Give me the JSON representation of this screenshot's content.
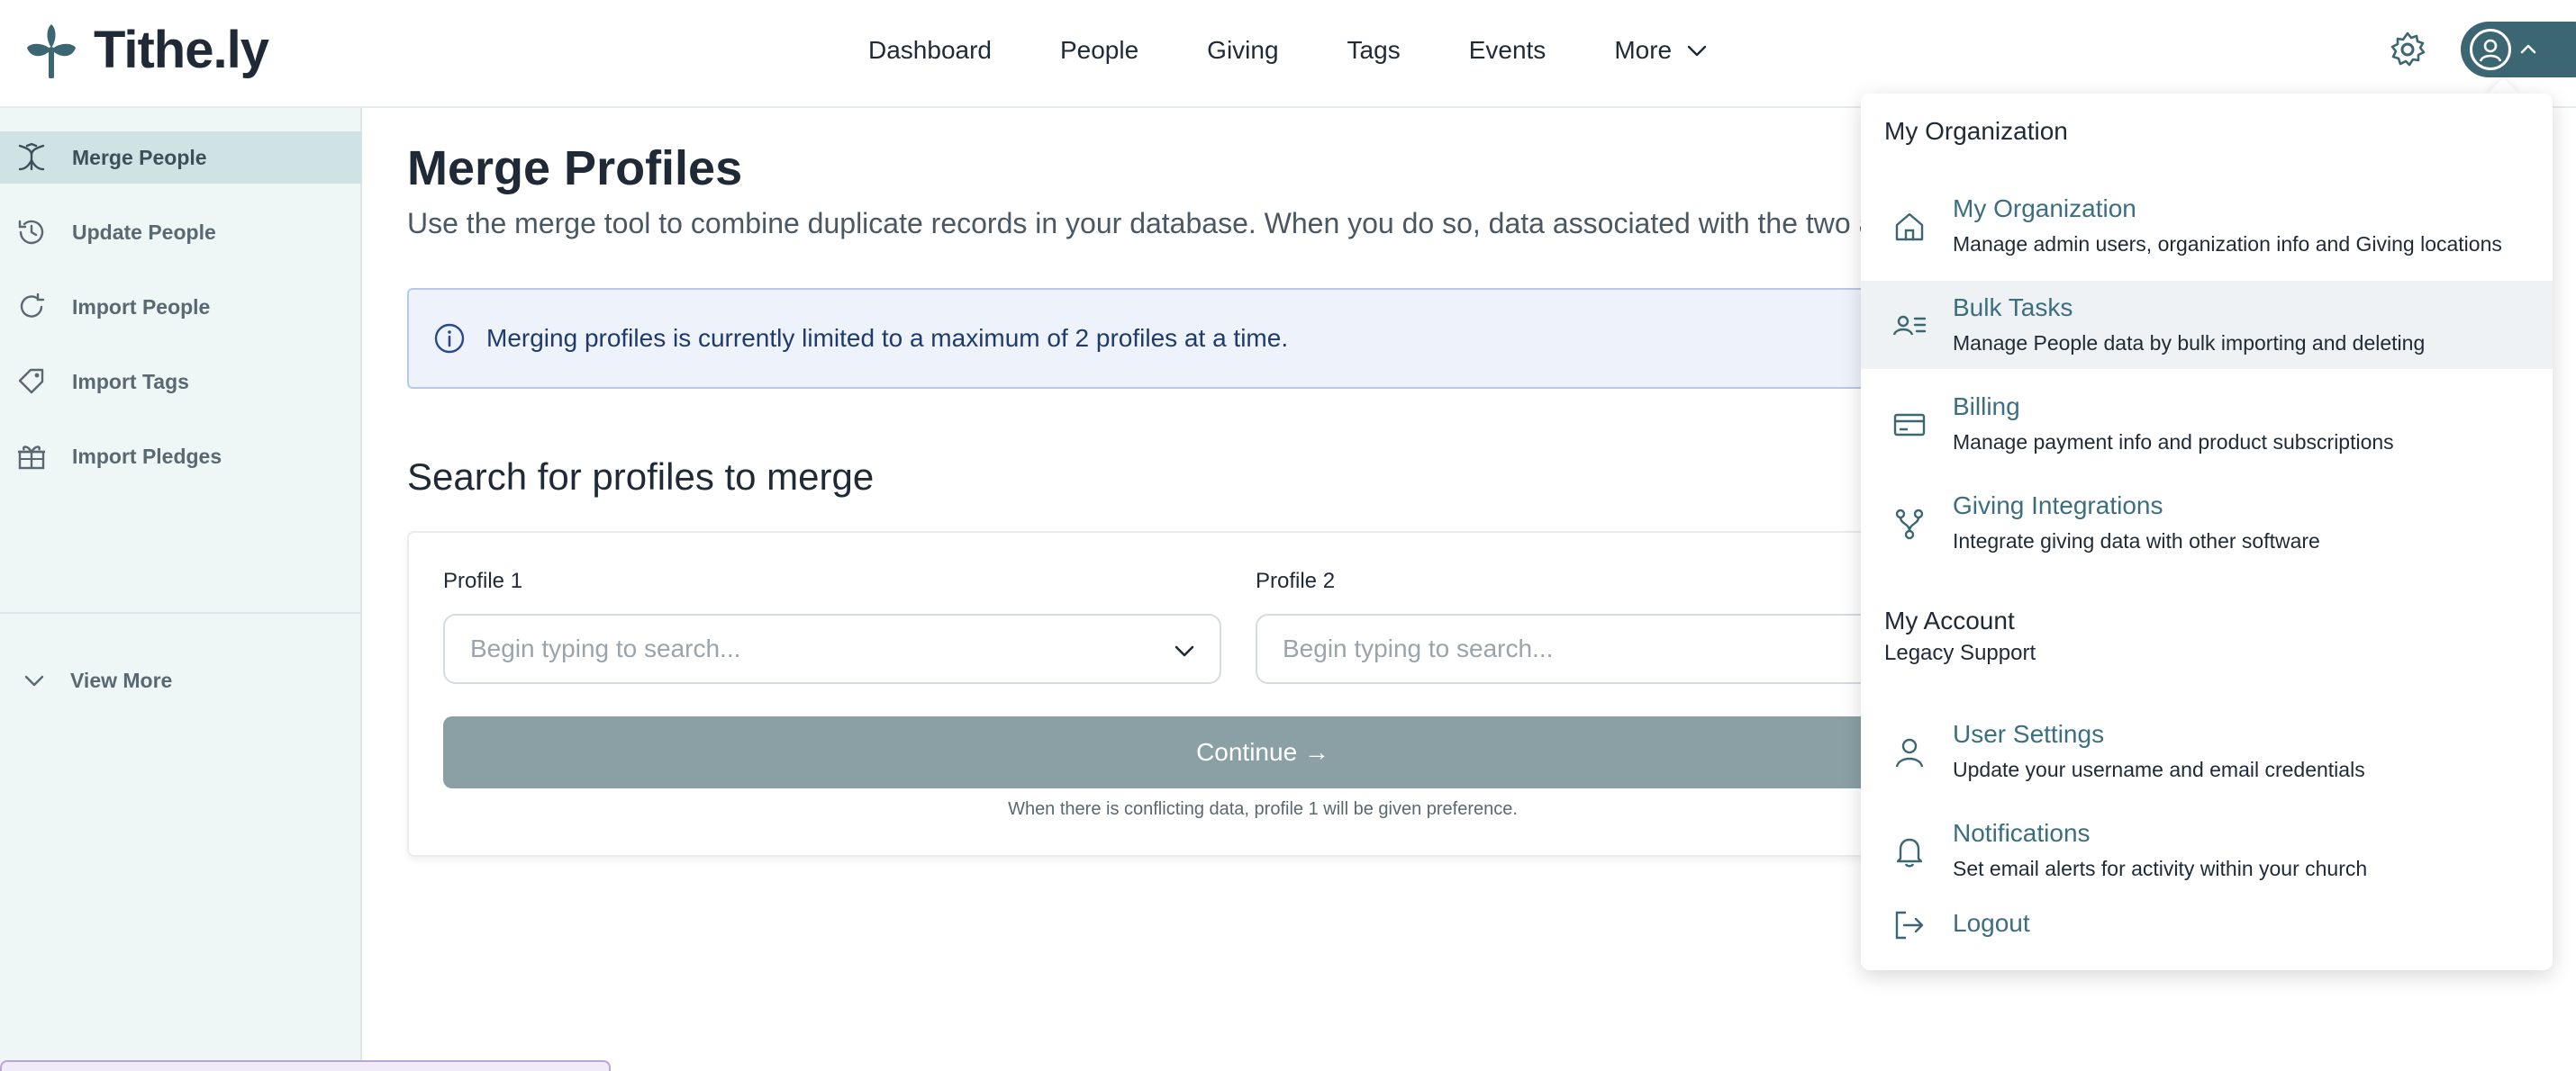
{
  "brand": {
    "name": "Tithe.ly"
  },
  "nav": {
    "items": [
      "Dashboard",
      "People",
      "Giving",
      "Tags",
      "Events"
    ],
    "more_label": "More"
  },
  "sidebar": {
    "items": [
      {
        "label": "Merge People",
        "icon": "merge-icon",
        "active": true
      },
      {
        "label": "Update People",
        "icon": "history-icon",
        "active": false
      },
      {
        "label": "Import People",
        "icon": "refresh-icon",
        "active": false
      },
      {
        "label": "Import Tags",
        "icon": "tag-icon",
        "active": false
      },
      {
        "label": "Import Pledges",
        "icon": "gift-icon",
        "active": false
      }
    ],
    "view_more_label": "View More"
  },
  "main": {
    "title": "Merge Profiles",
    "subtitle": "Use the merge tool to combine duplicate records in your database. When you do so, data associated with the two acco",
    "banner_text": "Merging profiles is currently limited to a maximum of 2 profiles at a time.",
    "section_title": "Search for profiles to merge",
    "profile1_label": "Profile 1",
    "profile2_label": "Profile 2",
    "search_placeholder": "Begin typing to search...",
    "continue_label": "Continue →",
    "hint": "When there is conflicting data, profile 1 will be given preference."
  },
  "menu": {
    "org_heading": "My Organization",
    "org_items": [
      {
        "title": "My Organization",
        "desc": "Manage admin users, organization info and Giving locations",
        "icon": "home-icon"
      },
      {
        "title": "Bulk Tasks",
        "desc": "Manage People data by bulk importing and deleting",
        "icon": "user-list-icon"
      },
      {
        "title": "Billing",
        "desc": "Manage payment info and product subscriptions",
        "icon": "credit-card-icon"
      },
      {
        "title": "Giving Integrations",
        "desc": "Integrate giving data with other software",
        "icon": "integration-icon"
      }
    ],
    "account_heading": "My Account",
    "account_name": "Legacy Support",
    "account_items": [
      {
        "title": "User Settings",
        "desc": "Update your username and email credentials",
        "icon": "user-icon"
      },
      {
        "title": "Notifications",
        "desc": "Set email alerts for activity within your church",
        "icon": "bell-icon"
      },
      {
        "title": "Logout",
        "desc": "",
        "icon": "logout-icon"
      }
    ]
  },
  "colors": {
    "accent": "#3b6672",
    "link": "#3b6f80",
    "sidebar_bg": "#eef7f6",
    "button_disabled": "#8aa0a4"
  }
}
